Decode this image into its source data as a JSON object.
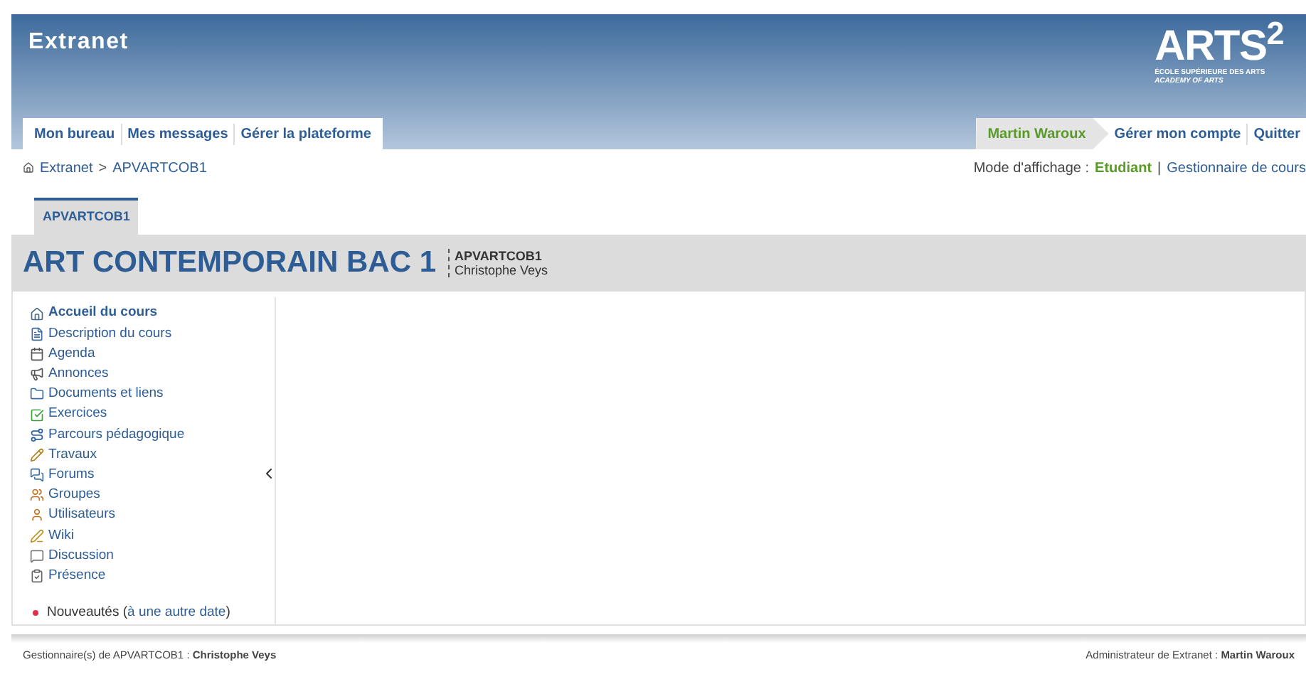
{
  "header": {
    "title": "Extranet",
    "logo": {
      "mark": "ARTS$^{2}$",
      "line_1": "ÉCOLE SUPÉRIEURE DES ARTS",
      "line_2": "ACADEMY OF ARTS"
    }
  },
  "nav": [
    {
      "label": "Mon bureau"
    },
    {
      "label": "Mes messages"
    },
    {
      "label": "Gérer la plateforme"
    }
  ],
  "user_nav": {
    "user": "Martin Waroux",
    "links": [
      "Gérer mon compte",
      "Quitter"
    ]
  },
  "breadcrumb": {
    "separator": ">",
    "items": [
      "Extranet",
      "APVARTCOB1"
    ]
  },
  "view_mode": {
    "label": "Mode d'affichage :",
    "separator": "|",
    "options": [
      {
        "label": "Etudiant",
        "selected": true
      },
      {
        "label": "Gestionnaire de cours",
        "selected": false
      }
    ]
  },
  "course_tab": {
    "label": "APVARTCOB1",
    "selected": true
  },
  "course": {
    "title": "ART CONTEMPORAIN BAC 1",
    "code": "APVARTCOB1",
    "teacher": "Christophe Veys"
  },
  "sidebar": {
    "items": [
      {
        "label": "Accueil du cours",
        "kind": "home",
        "selected": true
      },
      {
        "label": "Description du cours",
        "kind": "description",
        "selected": false
      },
      {
        "label": "Agenda",
        "kind": "calendar",
        "selected": false
      },
      {
        "label": "Annonces",
        "kind": "announcement",
        "selected": false
      },
      {
        "label": "Documents et liens",
        "kind": "folder",
        "selected": false
      },
      {
        "label": "Exercices",
        "kind": "check",
        "selected": false
      },
      {
        "label": "Parcours pédagogique",
        "kind": "path",
        "selected": false
      },
      {
        "label": "Travaux",
        "kind": "edit",
        "selected": false
      },
      {
        "label": "Forums",
        "kind": "forum",
        "selected": false
      },
      {
        "label": "Groupes",
        "kind": "group",
        "selected": false
      },
      {
        "label": "Utilisateurs",
        "kind": "user",
        "selected": false
      },
      {
        "label": "Wiki",
        "kind": "wiki",
        "selected": false
      },
      {
        "label": "Discussion",
        "kind": "chat",
        "selected": false
      },
      {
        "label": "Présence",
        "kind": "attendance",
        "selected": false
      }
    ],
    "news": {
      "label": "Nouveautés (",
      "link": "à une autre date",
      "end": ")",
      "color": "#e0304a"
    }
  },
  "footer": {
    "left": "Gestionnaire(s) de APVARTCOB1 : **Christophe Veys**",
    "right": "Administrateur de Extranet : **Martin Waroux**"
  }
}
